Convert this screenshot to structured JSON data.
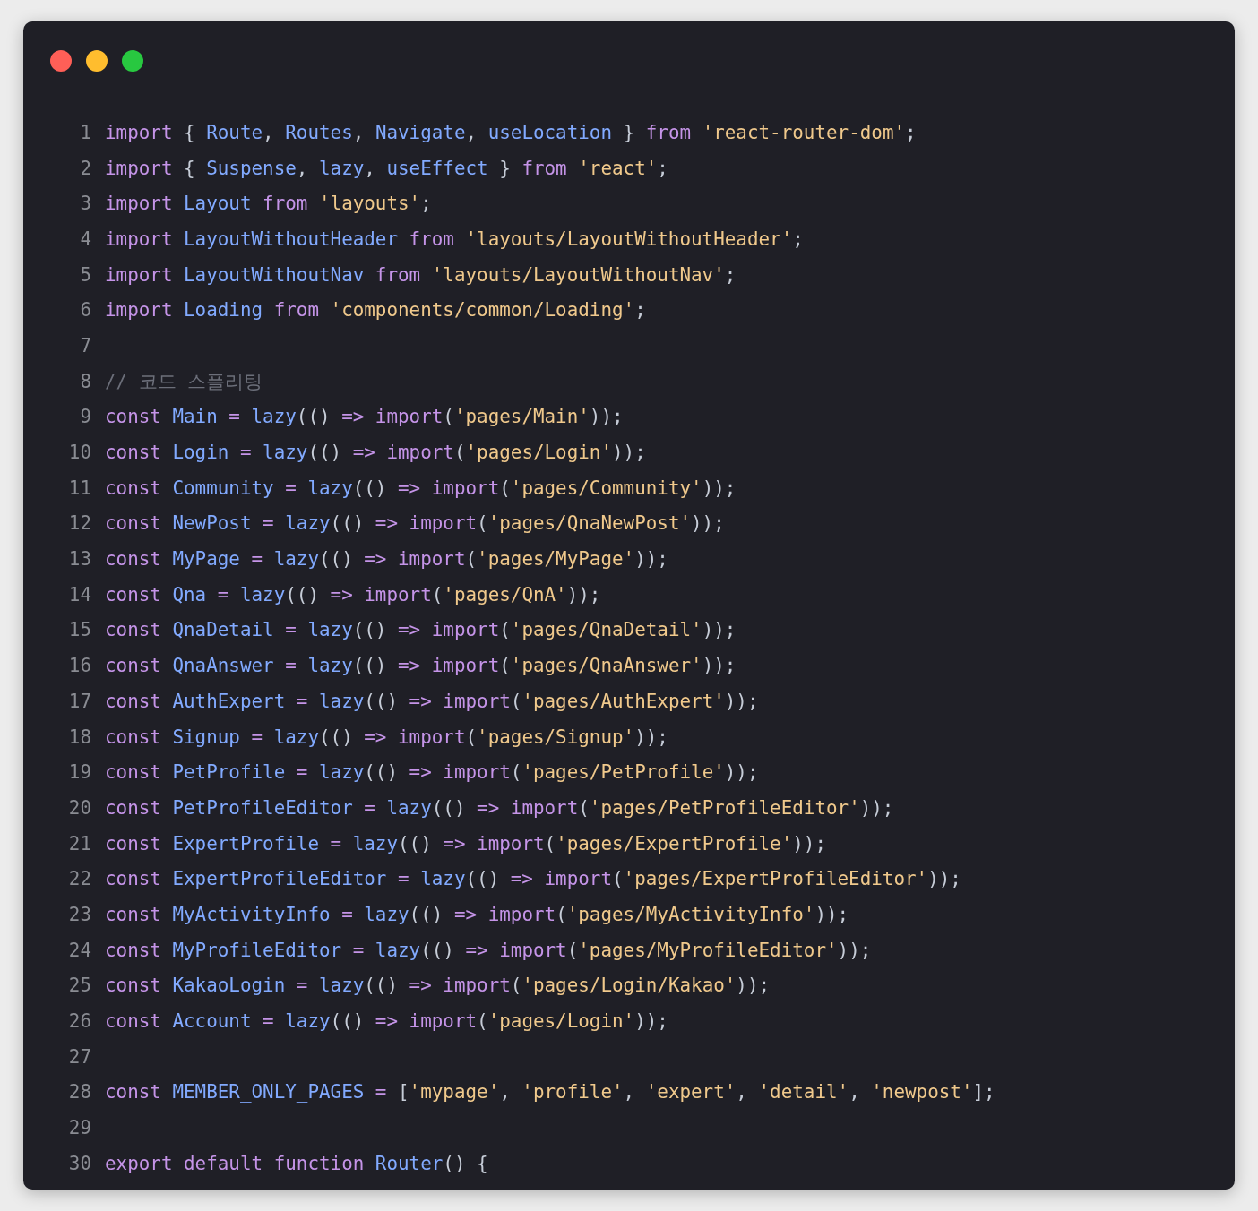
{
  "window": {
    "controls": [
      {
        "kind": "close"
      },
      {
        "kind": "minimize"
      },
      {
        "kind": "zoom"
      }
    ]
  },
  "lines": [
    {
      "number": "1",
      "tokens": [
        {
          "kind": "keyword",
          "text": "import"
        },
        {
          "kind": "punct",
          "text": " { "
        },
        {
          "kind": "ident",
          "text": "Route"
        },
        {
          "kind": "punct",
          "text": ", "
        },
        {
          "kind": "ident",
          "text": "Routes"
        },
        {
          "kind": "punct",
          "text": ", "
        },
        {
          "kind": "ident",
          "text": "Navigate"
        },
        {
          "kind": "punct",
          "text": ", "
        },
        {
          "kind": "ident",
          "text": "useLocation"
        },
        {
          "kind": "punct",
          "text": " } "
        },
        {
          "kind": "keyword",
          "text": "from"
        },
        {
          "kind": "string",
          "text": " 'react-router-dom'"
        },
        {
          "kind": "punct",
          "text": ";"
        }
      ]
    },
    {
      "number": "2",
      "tokens": [
        {
          "kind": "keyword",
          "text": "import"
        },
        {
          "kind": "punct",
          "text": " { "
        },
        {
          "kind": "ident",
          "text": "Suspense"
        },
        {
          "kind": "punct",
          "text": ", "
        },
        {
          "kind": "ident",
          "text": "lazy"
        },
        {
          "kind": "punct",
          "text": ", "
        },
        {
          "kind": "ident",
          "text": "useEffect"
        },
        {
          "kind": "punct",
          "text": " } "
        },
        {
          "kind": "keyword",
          "text": "from"
        },
        {
          "kind": "string",
          "text": " 'react'"
        },
        {
          "kind": "punct",
          "text": ";"
        }
      ]
    },
    {
      "number": "3",
      "tokens": [
        {
          "kind": "keyword",
          "text": "import"
        },
        {
          "kind": "ident",
          "text": " Layout"
        },
        {
          "kind": "keyword",
          "text": " from"
        },
        {
          "kind": "string",
          "text": " 'layouts'"
        },
        {
          "kind": "punct",
          "text": ";"
        }
      ]
    },
    {
      "number": "4",
      "tokens": [
        {
          "kind": "keyword",
          "text": "import"
        },
        {
          "kind": "ident",
          "text": " LayoutWithoutHeader"
        },
        {
          "kind": "keyword",
          "text": " from"
        },
        {
          "kind": "string",
          "text": " 'layouts/LayoutWithoutHeader'"
        },
        {
          "kind": "punct",
          "text": ";"
        }
      ]
    },
    {
      "number": "5",
      "tokens": [
        {
          "kind": "keyword",
          "text": "import"
        },
        {
          "kind": "ident",
          "text": " LayoutWithoutNav"
        },
        {
          "kind": "keyword",
          "text": " from"
        },
        {
          "kind": "string",
          "text": " 'layouts/LayoutWithoutNav'"
        },
        {
          "kind": "punct",
          "text": ";"
        }
      ]
    },
    {
      "number": "6",
      "tokens": [
        {
          "kind": "keyword",
          "text": "import"
        },
        {
          "kind": "ident",
          "text": " Loading"
        },
        {
          "kind": "keyword",
          "text": " from"
        },
        {
          "kind": "string",
          "text": " 'components/common/Loading'"
        },
        {
          "kind": "punct",
          "text": ";"
        }
      ]
    },
    {
      "number": "7"
    },
    {
      "number": "8",
      "tokens": [
        {
          "kind": "comment",
          "text": "// 코드 스플리팅"
        }
      ]
    },
    {
      "number": "9",
      "tokens": [
        {
          "kind": "keyword",
          "text": "const"
        },
        {
          "kind": "ident",
          "text": " Main"
        },
        {
          "kind": "operator",
          "text": " ="
        },
        {
          "kind": "ident",
          "text": " lazy"
        },
        {
          "kind": "punct",
          "text": "(()"
        },
        {
          "kind": "operator",
          "text": " =>"
        },
        {
          "kind": "keyword",
          "text": " import"
        },
        {
          "kind": "punct",
          "text": "("
        },
        {
          "kind": "string",
          "text": "'pages/Main'"
        },
        {
          "kind": "punct",
          "text": "));"
        }
      ]
    },
    {
      "number": "10",
      "tokens": [
        {
          "kind": "keyword",
          "text": "const"
        },
        {
          "kind": "ident",
          "text": " Login"
        },
        {
          "kind": "operator",
          "text": " ="
        },
        {
          "kind": "ident",
          "text": " lazy"
        },
        {
          "kind": "punct",
          "text": "(()"
        },
        {
          "kind": "operator",
          "text": " =>"
        },
        {
          "kind": "keyword",
          "text": " import"
        },
        {
          "kind": "punct",
          "text": "("
        },
        {
          "kind": "string",
          "text": "'pages/Login'"
        },
        {
          "kind": "punct",
          "text": "));"
        }
      ]
    },
    {
      "number": "11",
      "tokens": [
        {
          "kind": "keyword",
          "text": "const"
        },
        {
          "kind": "ident",
          "text": " Community"
        },
        {
          "kind": "operator",
          "text": " ="
        },
        {
          "kind": "ident",
          "text": " lazy"
        },
        {
          "kind": "punct",
          "text": "(()"
        },
        {
          "kind": "operator",
          "text": " =>"
        },
        {
          "kind": "keyword",
          "text": " import"
        },
        {
          "kind": "punct",
          "text": "("
        },
        {
          "kind": "string",
          "text": "'pages/Community'"
        },
        {
          "kind": "punct",
          "text": "));"
        }
      ]
    },
    {
      "number": "12",
      "tokens": [
        {
          "kind": "keyword",
          "text": "const"
        },
        {
          "kind": "ident",
          "text": " NewPost"
        },
        {
          "kind": "operator",
          "text": " ="
        },
        {
          "kind": "ident",
          "text": " lazy"
        },
        {
          "kind": "punct",
          "text": "(()"
        },
        {
          "kind": "operator",
          "text": " =>"
        },
        {
          "kind": "keyword",
          "text": " import"
        },
        {
          "kind": "punct",
          "text": "("
        },
        {
          "kind": "string",
          "text": "'pages/QnaNewPost'"
        },
        {
          "kind": "punct",
          "text": "));"
        }
      ]
    },
    {
      "number": "13",
      "tokens": [
        {
          "kind": "keyword",
          "text": "const"
        },
        {
          "kind": "ident",
          "text": " MyPage"
        },
        {
          "kind": "operator",
          "text": " ="
        },
        {
          "kind": "ident",
          "text": " lazy"
        },
        {
          "kind": "punct",
          "text": "(()"
        },
        {
          "kind": "operator",
          "text": " =>"
        },
        {
          "kind": "keyword",
          "text": " import"
        },
        {
          "kind": "punct",
          "text": "("
        },
        {
          "kind": "string",
          "text": "'pages/MyPage'"
        },
        {
          "kind": "punct",
          "text": "));"
        }
      ]
    },
    {
      "number": "14",
      "tokens": [
        {
          "kind": "keyword",
          "text": "const"
        },
        {
          "kind": "ident",
          "text": " Qna"
        },
        {
          "kind": "operator",
          "text": " ="
        },
        {
          "kind": "ident",
          "text": " lazy"
        },
        {
          "kind": "punct",
          "text": "(()"
        },
        {
          "kind": "operator",
          "text": " =>"
        },
        {
          "kind": "keyword",
          "text": " import"
        },
        {
          "kind": "punct",
          "text": "("
        },
        {
          "kind": "string",
          "text": "'pages/QnA'"
        },
        {
          "kind": "punct",
          "text": "));"
        }
      ]
    },
    {
      "number": "15",
      "tokens": [
        {
          "kind": "keyword",
          "text": "const"
        },
        {
          "kind": "ident",
          "text": " QnaDetail"
        },
        {
          "kind": "operator",
          "text": " ="
        },
        {
          "kind": "ident",
          "text": " lazy"
        },
        {
          "kind": "punct",
          "text": "(()"
        },
        {
          "kind": "operator",
          "text": " =>"
        },
        {
          "kind": "keyword",
          "text": " import"
        },
        {
          "kind": "punct",
          "text": "("
        },
        {
          "kind": "string",
          "text": "'pages/QnaDetail'"
        },
        {
          "kind": "punct",
          "text": "));"
        }
      ]
    },
    {
      "number": "16",
      "tokens": [
        {
          "kind": "keyword",
          "text": "const"
        },
        {
          "kind": "ident",
          "text": " QnaAnswer"
        },
        {
          "kind": "operator",
          "text": " ="
        },
        {
          "kind": "ident",
          "text": " lazy"
        },
        {
          "kind": "punct",
          "text": "(()"
        },
        {
          "kind": "operator",
          "text": " =>"
        },
        {
          "kind": "keyword",
          "text": " import"
        },
        {
          "kind": "punct",
          "text": "("
        },
        {
          "kind": "string",
          "text": "'pages/QnaAnswer'"
        },
        {
          "kind": "punct",
          "text": "));"
        }
      ]
    },
    {
      "number": "17",
      "tokens": [
        {
          "kind": "keyword",
          "text": "const"
        },
        {
          "kind": "ident",
          "text": " AuthExpert"
        },
        {
          "kind": "operator",
          "text": " ="
        },
        {
          "kind": "ident",
          "text": " lazy"
        },
        {
          "kind": "punct",
          "text": "(()"
        },
        {
          "kind": "operator",
          "text": " =>"
        },
        {
          "kind": "keyword",
          "text": " import"
        },
        {
          "kind": "punct",
          "text": "("
        },
        {
          "kind": "string",
          "text": "'pages/AuthExpert'"
        },
        {
          "kind": "punct",
          "text": "));"
        }
      ]
    },
    {
      "number": "18",
      "tokens": [
        {
          "kind": "keyword",
          "text": "const"
        },
        {
          "kind": "ident",
          "text": " Signup"
        },
        {
          "kind": "operator",
          "text": " ="
        },
        {
          "kind": "ident",
          "text": " lazy"
        },
        {
          "kind": "punct",
          "text": "(()"
        },
        {
          "kind": "operator",
          "text": " =>"
        },
        {
          "kind": "keyword",
          "text": " import"
        },
        {
          "kind": "punct",
          "text": "("
        },
        {
          "kind": "string",
          "text": "'pages/Signup'"
        },
        {
          "kind": "punct",
          "text": "));"
        }
      ]
    },
    {
      "number": "19",
      "tokens": [
        {
          "kind": "keyword",
          "text": "const"
        },
        {
          "kind": "ident",
          "text": " PetProfile"
        },
        {
          "kind": "operator",
          "text": " ="
        },
        {
          "kind": "ident",
          "text": " lazy"
        },
        {
          "kind": "punct",
          "text": "(()"
        },
        {
          "kind": "operator",
          "text": " =>"
        },
        {
          "kind": "keyword",
          "text": " import"
        },
        {
          "kind": "punct",
          "text": "("
        },
        {
          "kind": "string",
          "text": "'pages/PetProfile'"
        },
        {
          "kind": "punct",
          "text": "));"
        }
      ]
    },
    {
      "number": "20",
      "tokens": [
        {
          "kind": "keyword",
          "text": "const"
        },
        {
          "kind": "ident",
          "text": " PetProfileEditor"
        },
        {
          "kind": "operator",
          "text": " ="
        },
        {
          "kind": "ident",
          "text": " lazy"
        },
        {
          "kind": "punct",
          "text": "(()"
        },
        {
          "kind": "operator",
          "text": " =>"
        },
        {
          "kind": "keyword",
          "text": " import"
        },
        {
          "kind": "punct",
          "text": "("
        },
        {
          "kind": "string",
          "text": "'pages/PetProfileEditor'"
        },
        {
          "kind": "punct",
          "text": "));"
        }
      ]
    },
    {
      "number": "21",
      "tokens": [
        {
          "kind": "keyword",
          "text": "const"
        },
        {
          "kind": "ident",
          "text": " ExpertProfile"
        },
        {
          "kind": "operator",
          "text": " ="
        },
        {
          "kind": "ident",
          "text": " lazy"
        },
        {
          "kind": "punct",
          "text": "(()"
        },
        {
          "kind": "operator",
          "text": " =>"
        },
        {
          "kind": "keyword",
          "text": " import"
        },
        {
          "kind": "punct",
          "text": "("
        },
        {
          "kind": "string",
          "text": "'pages/ExpertProfile'"
        },
        {
          "kind": "punct",
          "text": "));"
        }
      ]
    },
    {
      "number": "22",
      "tokens": [
        {
          "kind": "keyword",
          "text": "const"
        },
        {
          "kind": "ident",
          "text": " ExpertProfileEditor"
        },
        {
          "kind": "operator",
          "text": " ="
        },
        {
          "kind": "ident",
          "text": " lazy"
        },
        {
          "kind": "punct",
          "text": "(()"
        },
        {
          "kind": "operator",
          "text": " =>"
        },
        {
          "kind": "keyword",
          "text": " import"
        },
        {
          "kind": "punct",
          "text": "("
        },
        {
          "kind": "string",
          "text": "'pages/ExpertProfileEditor'"
        },
        {
          "kind": "punct",
          "text": "));"
        }
      ]
    },
    {
      "number": "23",
      "tokens": [
        {
          "kind": "keyword",
          "text": "const"
        },
        {
          "kind": "ident",
          "text": " MyActivityInfo"
        },
        {
          "kind": "operator",
          "text": " ="
        },
        {
          "kind": "ident",
          "text": " lazy"
        },
        {
          "kind": "punct",
          "text": "(()"
        },
        {
          "kind": "operator",
          "text": " =>"
        },
        {
          "kind": "keyword",
          "text": " import"
        },
        {
          "kind": "punct",
          "text": "("
        },
        {
          "kind": "string",
          "text": "'pages/MyActivityInfo'"
        },
        {
          "kind": "punct",
          "text": "));"
        }
      ]
    },
    {
      "number": "24",
      "tokens": [
        {
          "kind": "keyword",
          "text": "const"
        },
        {
          "kind": "ident",
          "text": " MyProfileEditor"
        },
        {
          "kind": "operator",
          "text": " ="
        },
        {
          "kind": "ident",
          "text": " lazy"
        },
        {
          "kind": "punct",
          "text": "(()"
        },
        {
          "kind": "operator",
          "text": " =>"
        },
        {
          "kind": "keyword",
          "text": " import"
        },
        {
          "kind": "punct",
          "text": "("
        },
        {
          "kind": "string",
          "text": "'pages/MyProfileEditor'"
        },
        {
          "kind": "punct",
          "text": "));"
        }
      ]
    },
    {
      "number": "25",
      "tokens": [
        {
          "kind": "keyword",
          "text": "const"
        },
        {
          "kind": "ident",
          "text": " KakaoLogin"
        },
        {
          "kind": "operator",
          "text": " ="
        },
        {
          "kind": "ident",
          "text": " lazy"
        },
        {
          "kind": "punct",
          "text": "(()"
        },
        {
          "kind": "operator",
          "text": " =>"
        },
        {
          "kind": "keyword",
          "text": " import"
        },
        {
          "kind": "punct",
          "text": "("
        },
        {
          "kind": "string",
          "text": "'pages/Login/Kakao'"
        },
        {
          "kind": "punct",
          "text": "));"
        }
      ]
    },
    {
      "number": "26",
      "tokens": [
        {
          "kind": "keyword",
          "text": "const"
        },
        {
          "kind": "ident",
          "text": " Account"
        },
        {
          "kind": "operator",
          "text": " ="
        },
        {
          "kind": "ident",
          "text": " lazy"
        },
        {
          "kind": "punct",
          "text": "(()"
        },
        {
          "kind": "operator",
          "text": " =>"
        },
        {
          "kind": "keyword",
          "text": " import"
        },
        {
          "kind": "punct",
          "text": "("
        },
        {
          "kind": "string",
          "text": "'pages/Login'"
        },
        {
          "kind": "punct",
          "text": "));"
        }
      ]
    },
    {
      "number": "27"
    },
    {
      "number": "28",
      "tokens": [
        {
          "kind": "keyword",
          "text": "const"
        },
        {
          "kind": "ident",
          "text": " MEMBER_ONLY_PAGES"
        },
        {
          "kind": "operator",
          "text": " ="
        },
        {
          "kind": "punct",
          "text": " ["
        },
        {
          "kind": "string",
          "text": "'mypage'"
        },
        {
          "kind": "punct",
          "text": ","
        },
        {
          "kind": "string",
          "text": " 'profile'"
        },
        {
          "kind": "punct",
          "text": ","
        },
        {
          "kind": "string",
          "text": " 'expert'"
        },
        {
          "kind": "punct",
          "text": ","
        },
        {
          "kind": "string",
          "text": " 'detail'"
        },
        {
          "kind": "punct",
          "text": ","
        },
        {
          "kind": "string",
          "text": " 'newpost'"
        },
        {
          "kind": "punct",
          "text": "];"
        }
      ]
    },
    {
      "number": "29"
    },
    {
      "number": "30",
      "tokens": [
        {
          "kind": "keyword",
          "text": "export"
        },
        {
          "kind": "keyword",
          "text": " default"
        },
        {
          "kind": "keyword",
          "text": " function"
        },
        {
          "kind": "ident",
          "text": " Router"
        },
        {
          "kind": "punct",
          "text": "() {"
        }
      ]
    }
  ]
}
